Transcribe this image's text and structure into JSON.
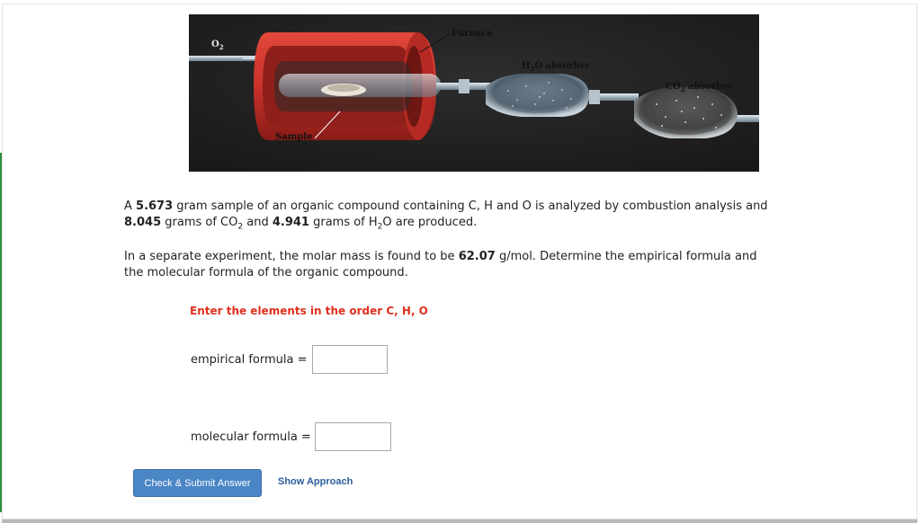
{
  "figure": {
    "labels": {
      "o2": "O",
      "o2_sub": "2",
      "furnace": "Furnace",
      "h2o_prefix": "H",
      "h2o_sub": "2",
      "h2o_suffix": "O absorber",
      "co2_prefix": "CO",
      "co2_sub": "2",
      "co2_suffix": " absorber",
      "sample": "Sample"
    },
    "colors": {
      "background": "#1f1f1f",
      "furnace_outer": "#c8322b",
      "furnace_inner": "#8e1f1a",
      "glass": "#a9b8c4"
    }
  },
  "problem": {
    "p1": {
      "t1": "A ",
      "mass_sample": "5.673",
      "t2": " gram sample of an organic compound containing C, H and O is analyzed by combustion analysis and",
      "mass_co2": "8.045",
      "t3": " grams of CO",
      "co2_sub": "2",
      "t4": " and ",
      "mass_h2o": "4.941",
      "t5": " grams of H",
      "h2o_sub": "2",
      "t6": "O are produced."
    },
    "p2": {
      "t1": "In a separate experiment, the molar mass is found to be ",
      "molar_mass": "62.07",
      "t2": " g/mol. Determine the empirical formula and",
      "t3": "the molecular formula of the organic compound."
    }
  },
  "instruction": "Enter the elements in the order C, H, O",
  "fields": {
    "empirical_label": "empirical formula =",
    "empirical_value": "",
    "molecular_label": "molecular formula =",
    "molecular_value": ""
  },
  "buttons": {
    "submit": "Check & Submit Answer",
    "approach": "Show Approach"
  },
  "colors": {
    "instruction": "#e0301e",
    "submit_bg": "#4a86c6",
    "link": "#2a5d9c"
  }
}
